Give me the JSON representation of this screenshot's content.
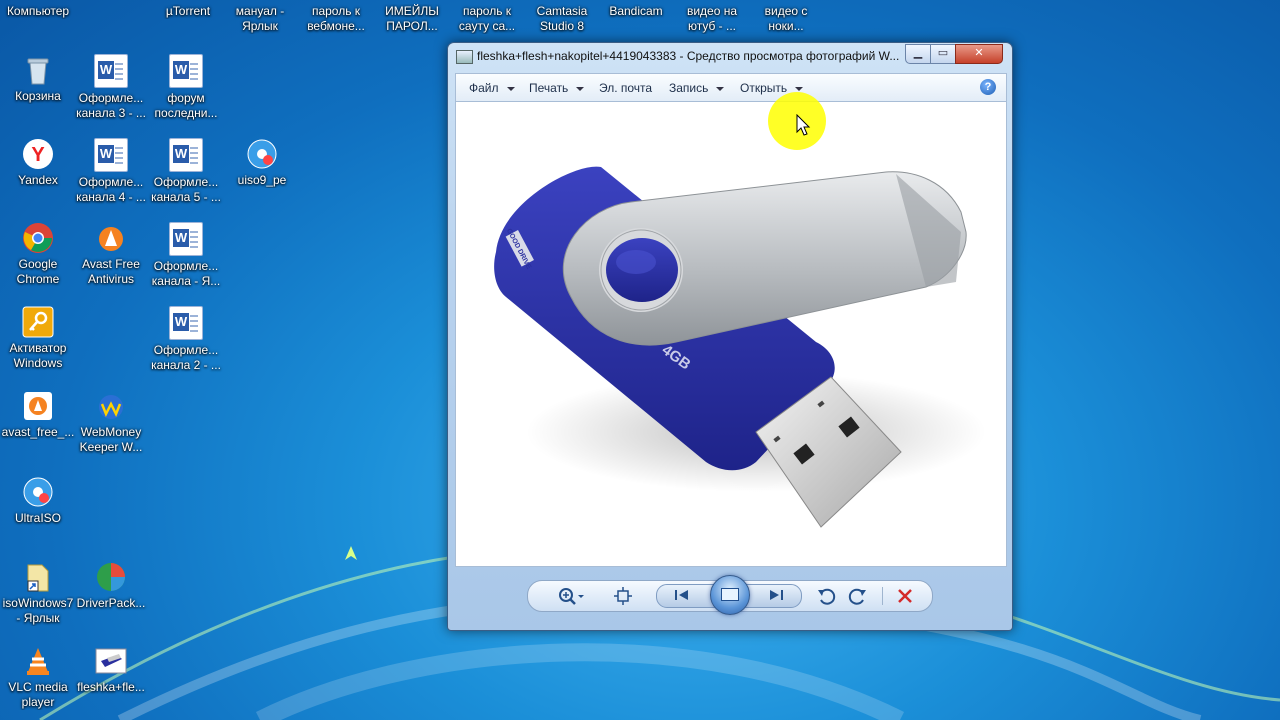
{
  "desktop": {
    "top_row": [
      {
        "label": "Компьютер"
      },
      {
        "label": "µTorrent"
      },
      {
        "label": "мануал -\nЯрлык"
      },
      {
        "label": "пароль к\nвебмоне..."
      },
      {
        "label": "ИМЕЙЛЫ\nПАРОЛ..."
      },
      {
        "label": "пароль к\nсаyту са..."
      },
      {
        "label": "Camtasia\nStudio 8"
      },
      {
        "label": "Bandicam"
      },
      {
        "label": "видео на\nютуб - ..."
      },
      {
        "label": "видео с\nноки..."
      }
    ],
    "icons": [
      {
        "label": "Корзина",
        "icon": "recycle-bin-icon"
      },
      {
        "label": "Оформле...\nканала 3 - ...",
        "icon": "word-doc-icon"
      },
      {
        "label": "форум\nпоследни...",
        "icon": "word-doc-icon"
      },
      {
        "label": "Yandex",
        "icon": "yandex-browser-icon"
      },
      {
        "label": "Оформле...\nканала 4 - ...",
        "icon": "word-doc-icon"
      },
      {
        "label": "Оформле...\nканала 5 - ...",
        "icon": "word-doc-icon"
      },
      {
        "label": "uiso9_pe",
        "icon": "ultraiso-installer-icon"
      },
      {
        "label": "Google\nChrome",
        "icon": "chrome-icon"
      },
      {
        "label": "Avast Free\nAntivirus",
        "icon": "avast-icon"
      },
      {
        "label": "Оформле...\nканала - Я...",
        "icon": "word-doc-icon"
      },
      {
        "label": "Активатор\nWindows",
        "icon": "key-icon"
      },
      {
        "label": "Оформле...\nканала 2 - ...",
        "icon": "word-doc-icon"
      },
      {
        "label": "avast_free_...",
        "icon": "avast-installer-icon"
      },
      {
        "label": "WebMoney\nKeeper W...",
        "icon": "webmoney-icon"
      },
      {
        "label": "UltraISO",
        "icon": "ultraiso-icon"
      },
      {
        "label": "isoWindows7\n- Ярлык",
        "icon": "shortcut-icon"
      },
      {
        "label": "DriverPack...",
        "icon": "driverpack-icon"
      },
      {
        "label": "VLC media\nplayer",
        "icon": "vlc-icon"
      },
      {
        "label": "fleshka+fle...",
        "icon": "image-file-icon"
      }
    ]
  },
  "viewer": {
    "title": "fleshka+flesh+nakopitel+4419043383 - Средство просмотра фотографий W...",
    "menu": {
      "file": "Файл",
      "print": "Печать",
      "email": "Эл. почта",
      "burn": "Запись",
      "open": "Открыть"
    },
    "help": "?",
    "photo": {
      "label_4gb": "4GB",
      "brand": "GOOD DRIVE"
    },
    "colors": {
      "drive_blue": "#2a2f9e",
      "metal": "#c8cacc",
      "cursor_highlight": "#ffff00"
    }
  }
}
